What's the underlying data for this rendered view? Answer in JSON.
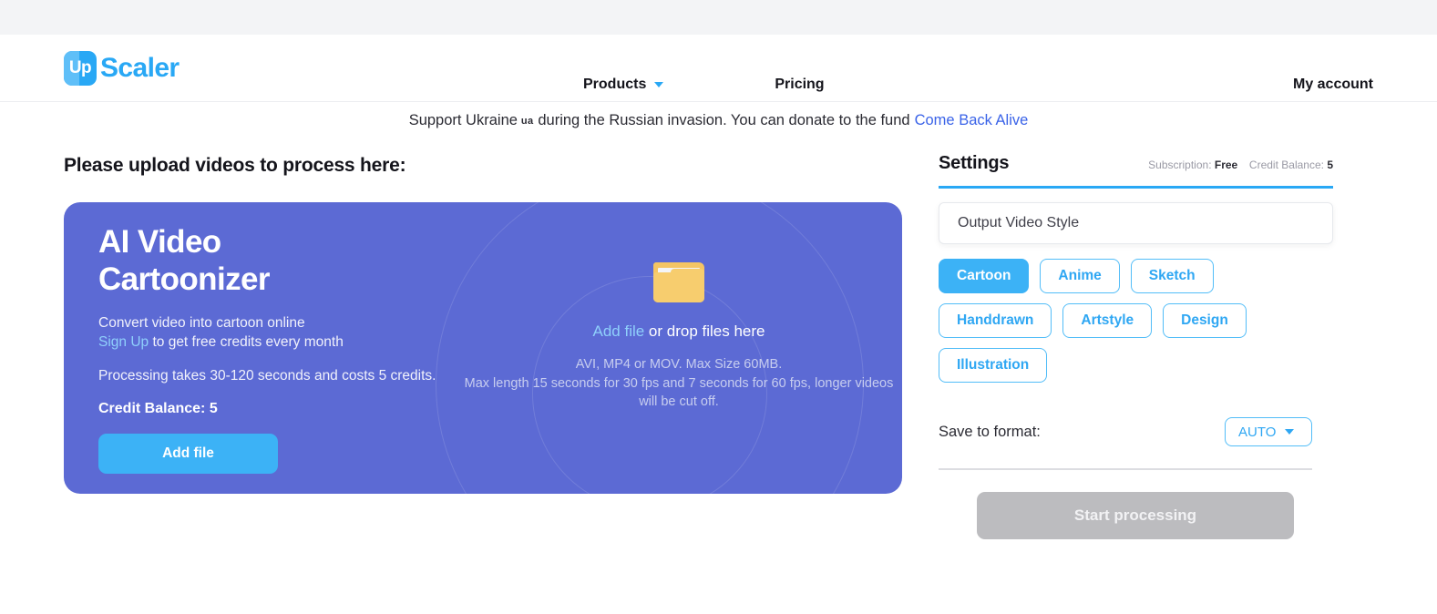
{
  "header": {
    "logo_mark_text": "Up",
    "logo_word": "Scaler",
    "nav": [
      {
        "label": "Products",
        "icon": "chevron-down-icon"
      },
      {
        "label": "Pricing"
      }
    ],
    "account_label": "My account"
  },
  "banner": {
    "text_before": "Support Ukraine",
    "flag": "ua",
    "text_middle": "during the Russian invasion. You can donate to the fund",
    "link_label": "Come Back Alive"
  },
  "main": {
    "page_title": "Please upload videos to process here:",
    "card": {
      "title_line1": "AI Video",
      "title_line2": "Cartoonizer",
      "subtitle": "Convert video into cartoon online",
      "signup_link": "Sign Up",
      "signup_rest": " to get free credits every month",
      "processing_note": "Processing takes 30-120 seconds and costs 5 credits.",
      "credit_balance": "Credit Balance: 5",
      "add_file_label": "Add file"
    },
    "dropzone": {
      "icon": "folder-icon",
      "link_label": "Add file",
      "main_rest": " or drop files here",
      "hint_line1": "AVI, MP4 or MOV. Max Size 60MB.",
      "hint_line2": "Max length 15 seconds for 30 fps and 7 seconds for 60 fps, longer videos will be cut off."
    }
  },
  "settings": {
    "title": "Settings",
    "subscription_label": "Subscription:",
    "subscription_value": "Free",
    "credit_label": "Credit Balance:",
    "credit_value": "5",
    "style_input_placeholder": "Output Video Style",
    "style_input_value": "",
    "styles": [
      {
        "label": "Cartoon",
        "selected": true
      },
      {
        "label": "Anime",
        "selected": false
      },
      {
        "label": "Sketch",
        "selected": false
      },
      {
        "label": "Handdrawn",
        "selected": false
      },
      {
        "label": "Artstyle",
        "selected": false
      },
      {
        "label": "Design",
        "selected": false
      },
      {
        "label": "Illustration",
        "selected": false
      }
    ],
    "format_label": "Save to format:",
    "format_value": "AUTO",
    "start_label": "Start processing"
  },
  "colors": {
    "brand_blue": "#29a8f5",
    "accent_blue": "#3cb2f6",
    "card_purple": "#5c6ad4",
    "link_blue": "#3a63e8",
    "folder_yellow": "#f7cd6e",
    "disabled_grey": "#bcbcbf"
  }
}
